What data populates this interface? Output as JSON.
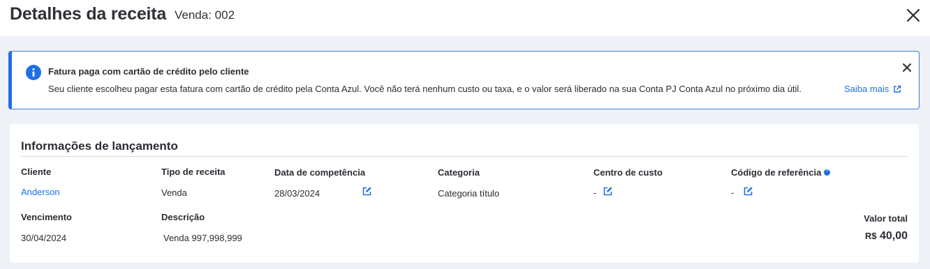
{
  "header": {
    "title": "Detalhes da receita",
    "subtitle": "Venda: 002"
  },
  "alert": {
    "heading": "Fatura paga com cartão de crédito pelo cliente",
    "message": "Seu cliente escolheu pagar esta fatura com cartão de crédito pela Conta Azul. Você não terá nenhum custo ou taxa, e o valor será liberado na sua Conta PJ Conta Azul no próximo dia útil.",
    "link_label": "Saiba mais"
  },
  "section": {
    "title": "Informações de lançamento",
    "fields": {
      "cliente": {
        "label": "Cliente",
        "value": "Anderson"
      },
      "tipo_receita": {
        "label": "Tipo de receita",
        "value": "Venda"
      },
      "data_competencia": {
        "label": "Data de competência",
        "value": "28/03/2024"
      },
      "categoria": {
        "label": "Categoria",
        "value": "Categoria título"
      },
      "centro_custo": {
        "label": "Centro de custo",
        "value": "-"
      },
      "codigo_referencia": {
        "label": "Código de referência",
        "value": "-"
      },
      "vencimento": {
        "label": "Vencimento",
        "value": "30/04/2024"
      },
      "descricao": {
        "label": "Descrição",
        "value": "Venda 997,998,999"
      }
    },
    "total": {
      "label": "Valor total",
      "currency": "R$",
      "amount": "40,00"
    }
  },
  "colors": {
    "accent": "#1f6fe5",
    "background": "#eef1f6",
    "text": "#2b2d33"
  }
}
